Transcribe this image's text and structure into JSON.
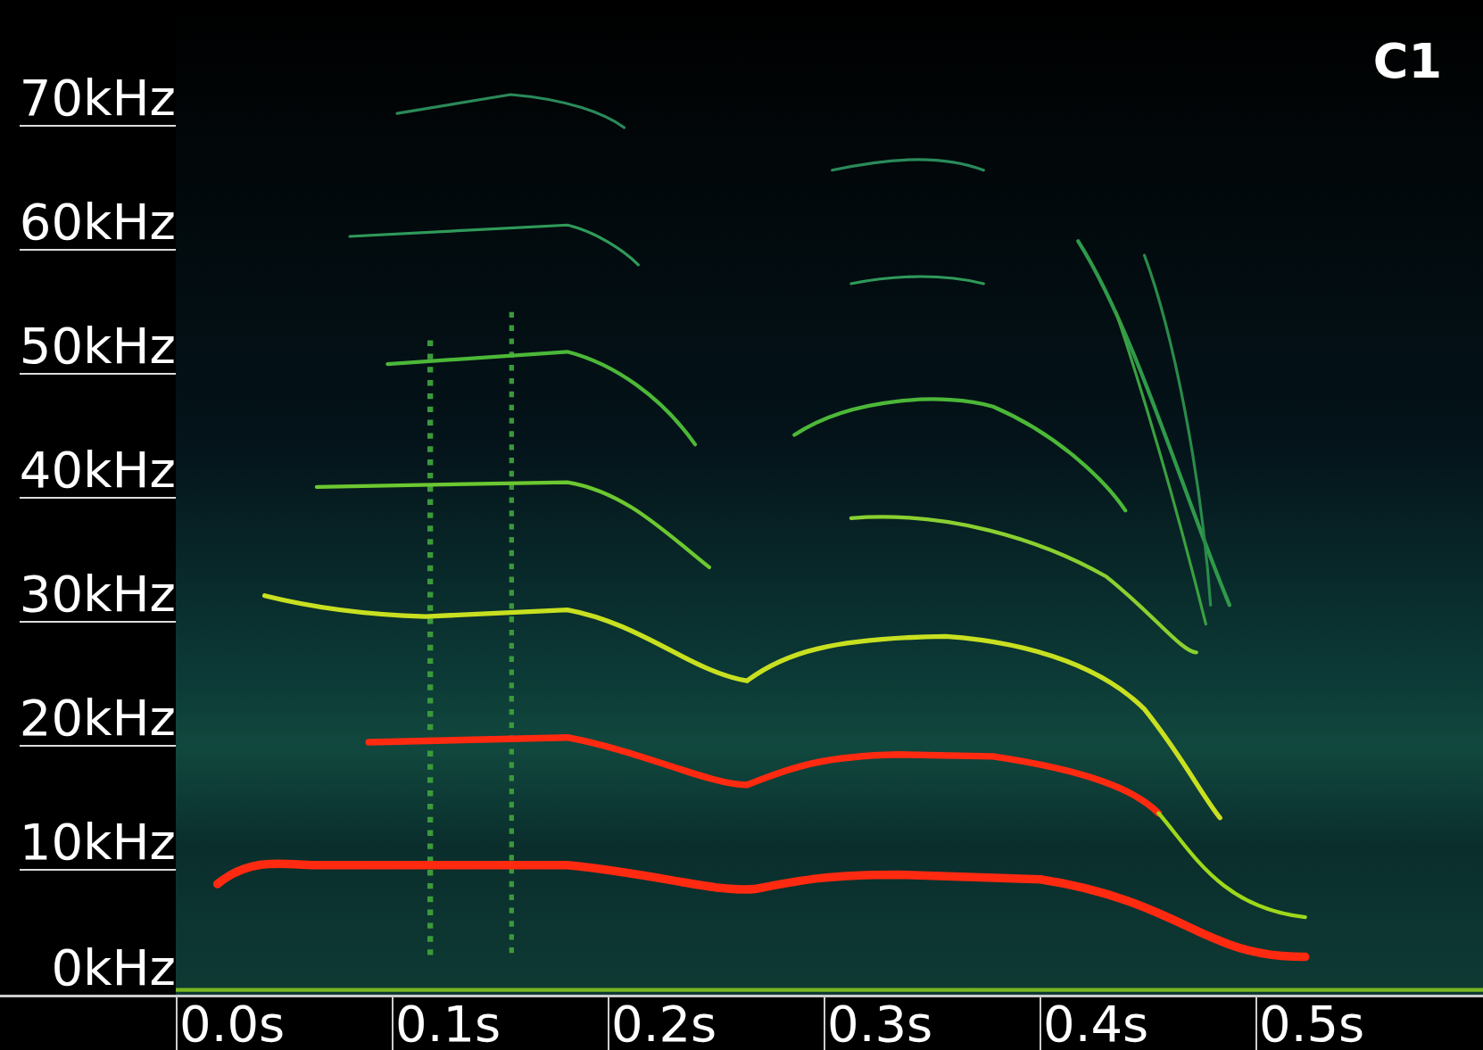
{
  "channel_label": "C1",
  "y_axis": {
    "labels": [
      "70kHz",
      "60kHz",
      "50kHz",
      "40kHz",
      "30kHz",
      "20kHz",
      "10kHz",
      "0kHz"
    ]
  },
  "x_axis": {
    "labels": [
      "0.0s",
      "0.1s",
      "0.2s",
      "0.3s",
      "0.4s",
      "0.5s"
    ]
  }
}
